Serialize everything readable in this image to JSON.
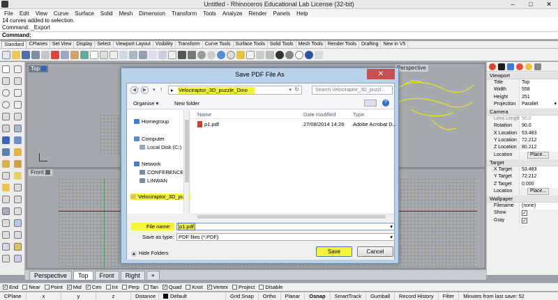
{
  "window": {
    "title": "Untitled - Rhinoceros Educational Lab License (32-bit)",
    "minimize": "–",
    "maximize": "□",
    "close": "✕"
  },
  "menu": [
    "File",
    "Edit",
    "View",
    "Curve",
    "Surface",
    "Solid",
    "Mesh",
    "Dimension",
    "Transform",
    "Tools",
    "Analyze",
    "Render",
    "Panels",
    "Help"
  ],
  "command": {
    "history": [
      "14 curves added to selection.",
      "Command: _Export"
    ],
    "prompt": "Command:"
  },
  "toolbar_tabs": [
    "Standard",
    "CPlanes",
    "Set View",
    "Display",
    "Select",
    "Viewport Layout",
    "Visibility",
    "Transform",
    "Curve Tools",
    "Surface Tools",
    "Solid Tools",
    "Mesh Tools",
    "Render Tools",
    "Drafting",
    "New in V5"
  ],
  "viewports": {
    "top_label": "Top",
    "front_label": "Front",
    "perspective_label": "Perspective",
    "right_label": "Right"
  },
  "viewport_tabs": [
    "Perspective",
    "Top",
    "Front",
    "Right",
    "+"
  ],
  "properties": {
    "viewport_section": "Viewport",
    "rows_viewport": [
      {
        "k": "Title",
        "v": "Top"
      },
      {
        "k": "Width",
        "v": "558"
      },
      {
        "k": "Height",
        "v": "251"
      },
      {
        "k": "Projection",
        "v": "Parallel"
      }
    ],
    "camera_section": "Camera",
    "rows_camera": [
      {
        "k": "Lens Length",
        "v": "50.0"
      },
      {
        "k": "Rotation",
        "v": "90.0"
      },
      {
        "k": "X Location",
        "v": "53.483"
      },
      {
        "k": "Y Location",
        "v": "72.212"
      },
      {
        "k": "Z Location",
        "v": "80.212"
      },
      {
        "k": "Location",
        "v": "Place..."
      }
    ],
    "target_section": "Target",
    "rows_target": [
      {
        "k": "X Target",
        "v": "53.483"
      },
      {
        "k": "Y Target",
        "v": "72.212"
      },
      {
        "k": "Z Target",
        "v": "0.000"
      },
      {
        "k": "Location",
        "v": "Place..."
      }
    ],
    "wallpaper_section": "Wallpaper",
    "rows_wallpaper": [
      {
        "k": "Filename",
        "v": "(none)"
      },
      {
        "k": "Show",
        "v": "✓"
      },
      {
        "k": "Gray",
        "v": "✓"
      }
    ]
  },
  "osnaps": [
    {
      "label": "End",
      "checked": true
    },
    {
      "label": "Near",
      "checked": false
    },
    {
      "label": "Point",
      "checked": false
    },
    {
      "label": "Mid",
      "checked": true
    },
    {
      "label": "Cen",
      "checked": true
    },
    {
      "label": "Int",
      "checked": false
    },
    {
      "label": "Perp",
      "checked": false
    },
    {
      "label": "Tan",
      "checked": false
    },
    {
      "label": "Quad",
      "checked": true
    },
    {
      "label": "Knot",
      "checked": false
    },
    {
      "label": "Vertex",
      "checked": true
    },
    {
      "label": "Project",
      "checked": false
    },
    {
      "label": "Disable",
      "checked": false
    }
  ],
  "status": [
    "CPlane",
    "x",
    "y",
    "z",
    "Distance",
    "Default",
    "Grid Snap",
    "Ortho",
    "Planar",
    "Osnap",
    "SmartTrack",
    "Gumball",
    "Record History",
    "Filter",
    "Minutes from last save: 52"
  ],
  "dialog": {
    "title": "Save PDF File As",
    "close": "✕",
    "address_sep": "▸",
    "address": "Velociraptor_3D_puzzle_Dino",
    "search_placeholder": "Search Velociraptor_3D_puzzl...",
    "organise": "Organise ▾",
    "new_folder": "New folder",
    "nav_items": [
      "Homegroup",
      "Computer",
      "Local Disk (C:)",
      "Network",
      "CONFERENCE-PC",
      "LINWAN",
      "Velociraptor_3D_pu..."
    ],
    "columns": [
      "Name",
      "Date modified",
      "Type"
    ],
    "files": [
      {
        "name": "p1.pdf",
        "date": "27/08/2014 14:26",
        "type": "Adobe Acrobat D..."
      }
    ],
    "file_name_label": "File name:",
    "file_name_value": "p1.pdf",
    "save_type_label": "Save as type:",
    "save_type_value": "PDF files (*.PDF)",
    "hide_folders": "Hide Folders",
    "save": "Save",
    "cancel": "Cancel"
  }
}
